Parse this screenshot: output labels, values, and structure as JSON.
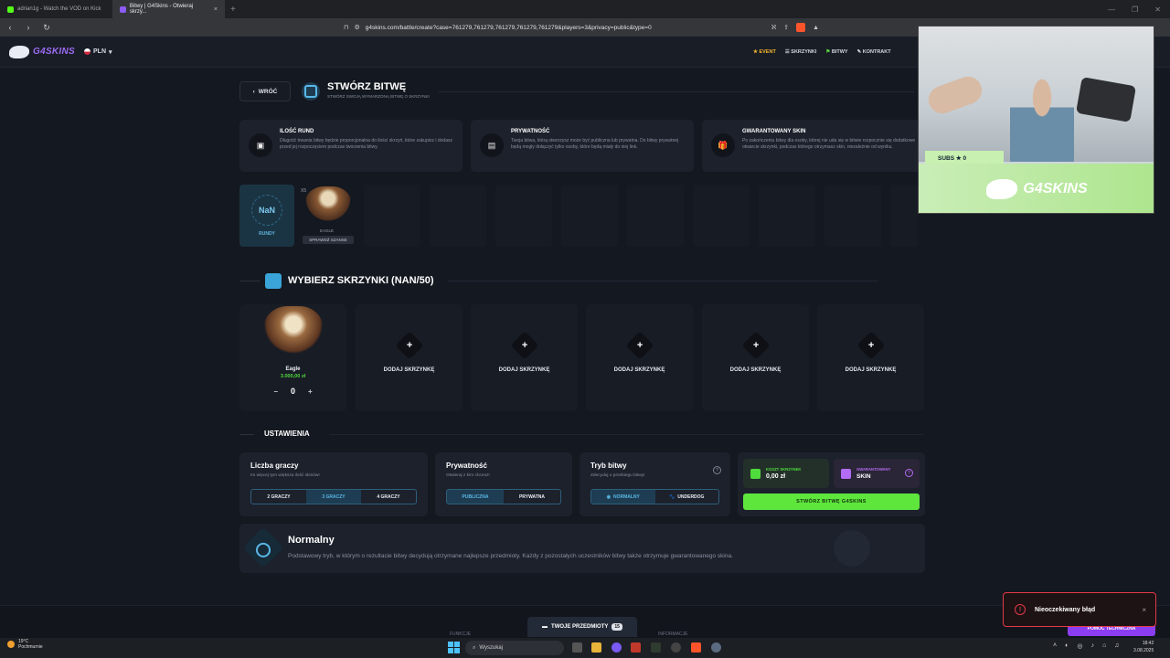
{
  "browser": {
    "tabs": [
      {
        "label": "adrian1g - Watch the VOD on Kick",
        "favicon_color": "#53fc18"
      },
      {
        "label": "Bitwy | G4Skins - Otwieraj skrzy...",
        "favicon_color": "#8b5cf6"
      }
    ],
    "url": "g4skins.com/battle/create?case=761279,761279,761279,761279,761279&players=3&privacy=public&type=0",
    "brave_badge": "4"
  },
  "header": {
    "logo_text": "G4SKINS",
    "currency": "PLN",
    "nav": [
      {
        "label": "EVENT",
        "icon": "star-icon"
      },
      {
        "label": "SKRZYNKI",
        "icon": "list-icon"
      },
      {
        "label": "BITWY",
        "icon": "battle-icon"
      },
      {
        "label": "KONTRAKT",
        "icon": "pen-icon"
      }
    ]
  },
  "page": {
    "back_label": "WRÓĆ",
    "title": "STWÓRZ BITWĘ",
    "subtitle": "STWÓRZ SWOJĄ WYMARZONĄ BITWĘ O SKRZYNKI"
  },
  "info_cards": [
    {
      "title": "ILOŚĆ RUND",
      "icon": "box-icon",
      "text": "Długość trwania bitwy będzie proporcjonalna do ilości skrzyń, które zakupisz i dodasz przed jej rozpoczęciem podczas tworzenia bitwy."
    },
    {
      "title": "PRYWATNOŚĆ",
      "icon": "document-icon",
      "text": "Twoja bitwa, którą stworzysz może być publiczna lub prywatna. Do bitwy prywatnej będą mogły dołączyć tylko osoby, które będą miały do niej link."
    },
    {
      "title": "GWARANTOWANY SKIN",
      "icon": "gift-icon",
      "text": "Po zakończeniu bitwy dla osoby, której nie uda się w bitwie rozpocznie się dodatkowe otwarcie skrzynki, podczas którego otrzymasz skin, niezależnie od wyniku."
    }
  ],
  "rounds": {
    "value": "NaN",
    "label": "RUNDY",
    "case_multiplier": "X5",
    "case_name": "EAGLE",
    "chance_button": "SPRAWDŹ SZANSE"
  },
  "choose_section": {
    "title": "WYBIERZ SKRZYNKI (NAN/50)",
    "selected_case": {
      "name": "Eagle",
      "price": "3.000,00 zł",
      "quantity": "0",
      "minus": "−",
      "plus": "+"
    },
    "add_slots": [
      "DODAJ SKRZYNKĘ",
      "DODAJ SKRZYNKĘ",
      "DODAJ SKRZYNKĘ",
      "DODAJ SKRZYNKĘ",
      "DODAJ SKRZYNKĘ"
    ],
    "plus_symbol": "+"
  },
  "settings": {
    "title": "USTAWIENIA",
    "players": {
      "title": "Liczba graczy",
      "hint": "Im więcej tym większa ilość skinów!",
      "options": [
        "2 GRACZY",
        "3 GRACZY",
        "4 GRACZY"
      ],
      "selected_index": 1
    },
    "privacy": {
      "title": "Prywatność",
      "hint": "Otwieraj z kim chcesz!",
      "options": [
        "PUBLICZNA",
        "PRYWATNA"
      ],
      "selected_index": 0
    },
    "mode": {
      "title": "Tryb bitwy",
      "hint": "Zdecyduj o przebiegu bitwy!",
      "options": [
        "NORMALNY",
        "UNDERDOG"
      ],
      "selected_index": 0,
      "help": "?"
    }
  },
  "cost": {
    "label": "KOSZT SKRZYNEK",
    "value": "0,00 zł",
    "guaranteed_label": "GWARANTOWANY",
    "guaranteed_value": "SKIN",
    "help": "?",
    "create_button": "STWÓRZ BITWĘ G4SKINS"
  },
  "mode_info": {
    "title": "Normalny",
    "description": "Podstawowy tryb, w którym o rezultacie bitwy decydują otrzymane najlepsze przedmioty. Każdy z pozostałych uczestników bitwy także otrzymuje gwarantowanego skina."
  },
  "footer": {
    "items_tab": "TWOJE PRZEDMIOTY",
    "items_count": "15",
    "col1": "FUNKCJE",
    "col2": "INFORMACJE",
    "support_button": "POMOC TECHNICZNA"
  },
  "toast": {
    "message": "Nieoczekiwany błąd",
    "icon": "!",
    "close": "×"
  },
  "webcam": {
    "subs_label": "SUBS ★ 0",
    "brand": "G4SKINS"
  },
  "taskbar": {
    "weather_temp": "19°C",
    "weather_desc": "Pochmurnie",
    "search_placeholder": "Wyszukaj",
    "time": "18:42",
    "date": "3.08.2025"
  },
  "colors": {
    "accent_green": "#5ee63d",
    "accent_blue": "#5ab7e6",
    "accent_purple": "#8b3df2",
    "error_red": "#e23a48"
  }
}
